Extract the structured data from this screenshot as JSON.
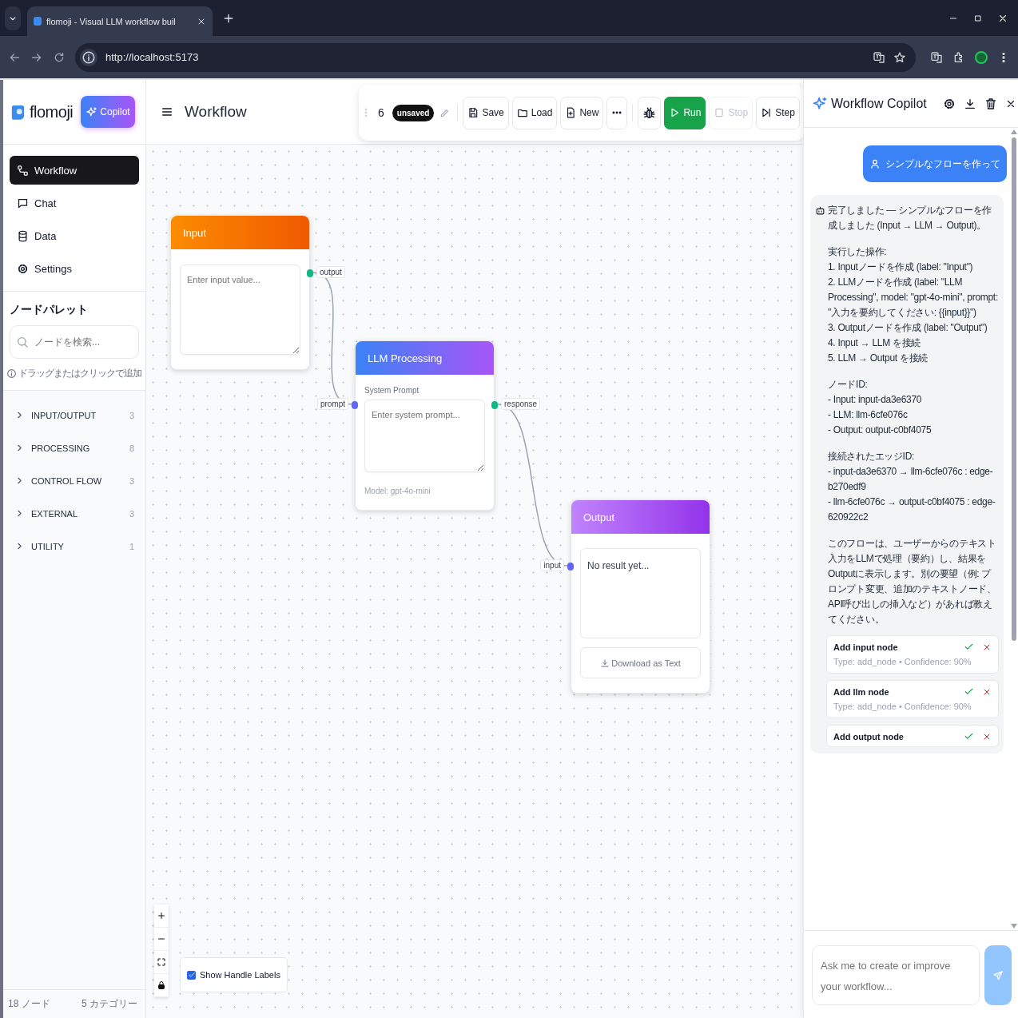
{
  "browser": {
    "tab_title": "flomoji - Visual LLM workflow buil",
    "url": "http://localhost:5173"
  },
  "sidebar": {
    "logo": "flomoji",
    "copilot_button": "Copilot",
    "nav": [
      {
        "label": "Workflow",
        "kind": "workflow",
        "selected": true
      },
      {
        "label": "Chat",
        "kind": "chat",
        "selected": false
      },
      {
        "label": "Data",
        "kind": "data",
        "selected": false
      },
      {
        "label": "Settings",
        "kind": "settings",
        "selected": false
      }
    ],
    "palette": {
      "title": "ノードパレット",
      "search_placeholder": "ノードを検索...",
      "hint": "ドラッグまたはクリックで追加",
      "categories": [
        {
          "label": "INPUT/OUTPUT",
          "count": "3",
          "expanded": false
        },
        {
          "label": "PROCESSING",
          "count": "8",
          "expanded": false
        },
        {
          "label": "CONTROL FLOW",
          "count": "3",
          "expanded": false
        },
        {
          "label": "EXTERNAL",
          "count": "3",
          "expanded": false
        },
        {
          "label": "UTILITY",
          "count": "1",
          "expanded": false
        }
      ]
    },
    "footer": {
      "node_count": "18 ノード",
      "category_count": "5 カテゴリー"
    }
  },
  "header": {
    "title": "Workflow"
  },
  "toolbar": {
    "count": "6",
    "status": "unsaved",
    "buttons": [
      {
        "kind": "save",
        "label": "Save",
        "disabled": false
      },
      {
        "kind": "load",
        "label": "Load",
        "disabled": false
      },
      {
        "kind": "new",
        "label": "New",
        "disabled": false
      },
      {
        "kind": "more",
        "disabled": false
      },
      {
        "kind": "debug",
        "disabled": false
      },
      {
        "kind": "run",
        "label": "Run",
        "disabled": false
      },
      {
        "kind": "stop",
        "label": "Stop",
        "disabled": true
      },
      {
        "kind": "step",
        "label": "Step",
        "disabled": false
      }
    ]
  },
  "canvas": {
    "nodes": [
      {
        "kind": "input",
        "title": "Input",
        "placeholder": "Enter input value...",
        "handles": [
          {
            "kind": "source",
            "label": "output"
          }
        ]
      },
      {
        "kind": "llm",
        "title": "LLM Processing",
        "field_label": "System Prompt",
        "placeholder": "Enter system prompt...",
        "footer": "Model: gpt-4o-mini",
        "handles": [
          {
            "kind": "target",
            "label": "prompt"
          },
          {
            "kind": "source",
            "label": "response"
          }
        ]
      },
      {
        "kind": "output",
        "title": "Output",
        "result": "No result yet...",
        "button": "Download as Text",
        "handles": [
          {
            "kind": "target",
            "label": "input"
          }
        ]
      }
    ],
    "show_handle_labels": {
      "label": "Show Handle Labels",
      "checked": true
    }
  },
  "copilot": {
    "title": "Workflow Copilot",
    "messages": [
      {
        "kind": "user",
        "text": "シンプルなフローを作って"
      },
      {
        "kind": "assistant",
        "paragraphs": [
          "完了しました — シンプルなフローを作成しました (Input → LLM → Output)。",
          "実行した操作:\n1. Inputノードを作成 (label: \"Input\")\n2. LLMノードを作成 (label: \"LLM Processing\", model: \"gpt-4o-mini\", prompt: \"入力を要約してください: {{input}}\")\n3. Outputノードを作成 (label: \"Output\")\n4. Input → LLM を接続\n5. LLM → Output を接続",
          "ノードID:\n- Input: input-da3e6370\n- LLM: llm-6cfe076c\n- Output: output-c0bf4075",
          "接続されたエッジID:\n- input-da3e6370 → llm-6cfe076c : edge-b270edf9\n- llm-6cfe076c → output-c0bf4075 : edge-620922c2",
          "このフローは、ユーザーからのテキスト入力をLLMで処理（要約）し、結果をOutputに表示します。別の要望（例: プロンプト変更、追加のテキストノード、API呼び出しの挿入など）があれば教えてください。"
        ],
        "suggestions": [
          {
            "title": "Add input node",
            "detail": "Type: add_node • Confidence: 90%"
          },
          {
            "title": "Add llm node",
            "detail": "Type: add_node • Confidence: 90%"
          },
          {
            "title": "Add output node"
          }
        ]
      }
    ],
    "input_placeholder": "Ask me to create or improve your workflow...",
    "send_disabled": true
  }
}
